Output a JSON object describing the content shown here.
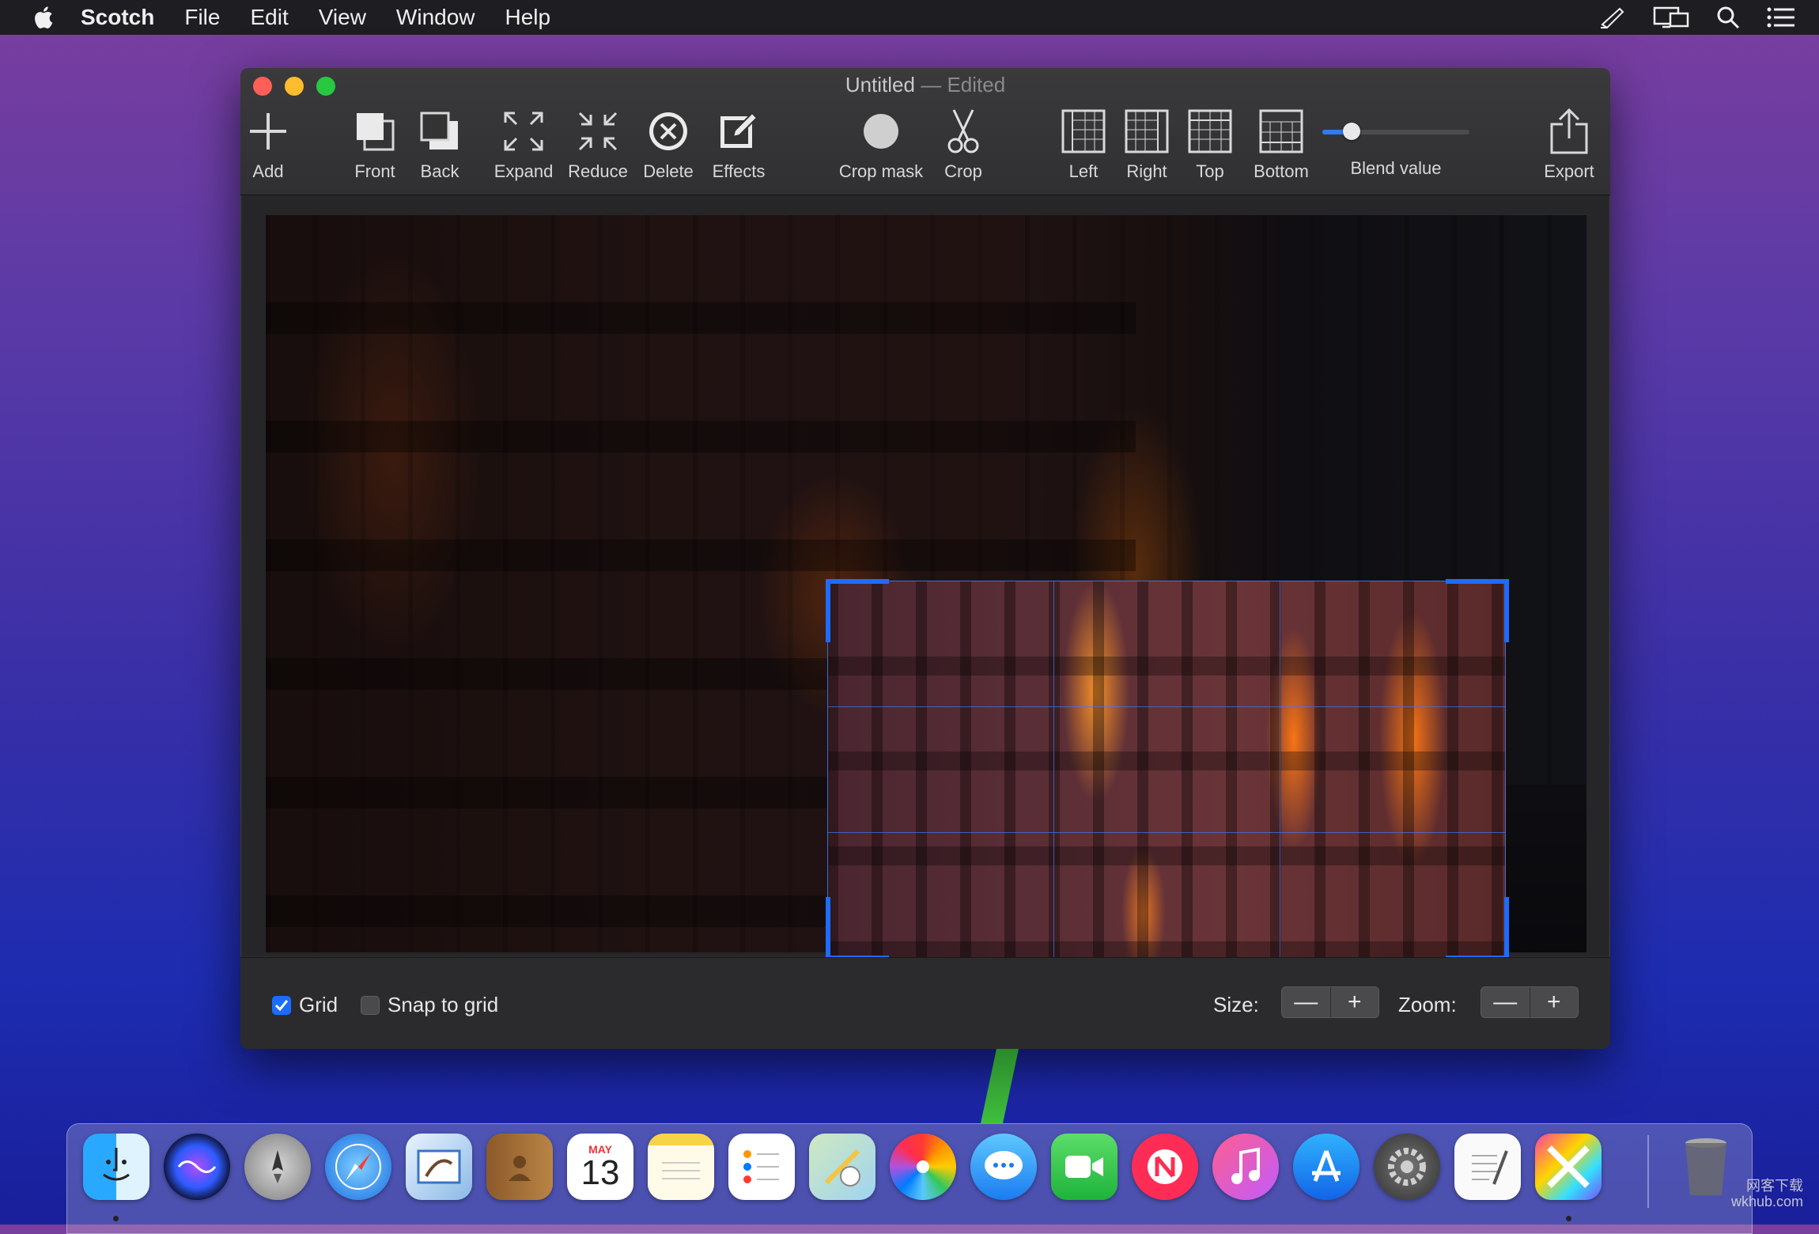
{
  "menubar": {
    "app_name": "Scotch",
    "items": [
      "File",
      "Edit",
      "View",
      "Window",
      "Help"
    ]
  },
  "window": {
    "title": "Untitled",
    "title_separator": "—",
    "title_status": "Edited"
  },
  "toolbar": {
    "add": "Add",
    "front": "Front",
    "back": "Back",
    "expand": "Expand",
    "reduce": "Reduce",
    "delete": "Delete",
    "effects": "Effects",
    "crop_mask": "Crop mask",
    "crop": "Crop",
    "left": "Left",
    "right": "Right",
    "top": "Top",
    "bottom": "Bottom",
    "blend_value_label": "Blend value",
    "blend_value": 0.2,
    "export": "Export"
  },
  "bottombar": {
    "grid_label": "Grid",
    "grid_checked": true,
    "snap_label": "Snap to grid",
    "snap_checked": false,
    "size_label": "Size:",
    "zoom_label": "Zoom:",
    "minus": "—",
    "plus": "+"
  },
  "dock": {
    "calendar_month": "MAY",
    "calendar_day": "13"
  },
  "watermark": {
    "line1": "网客下载",
    "line2": "wkhub.com"
  },
  "colors": {
    "accent": "#1e6bff",
    "menubar_bg": "#1e1d21",
    "window_bg": "#2a2a2c"
  }
}
